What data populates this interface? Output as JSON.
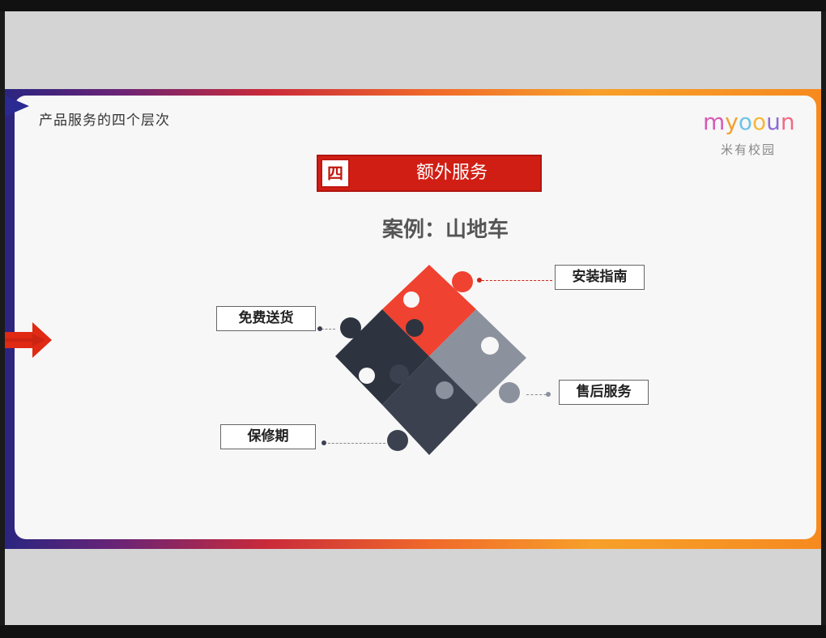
{
  "slide": {
    "section_title": "产品服务的四个层次",
    "logo": {
      "letters": [
        "m",
        "y",
        "o",
        "o",
        "u",
        "n"
      ],
      "letter_colors": [
        "#d65ab5",
        "#f2a030",
        "#6fc3e8",
        "#f6b83a",
        "#8d6cd6",
        "#f06a85"
      ],
      "subtitle": "米有校园"
    },
    "tag": {
      "number": "四",
      "label": "额外服务",
      "color": "#d11e14"
    },
    "case_title": "案例：山地车",
    "callouts": {
      "top_right": "安装指南",
      "left_upper": "免费送货",
      "right_lower": "售后服务",
      "left_lower": "保修期"
    },
    "colors": {
      "red_piece": "#f04230",
      "gray_piece": "#8c919e",
      "dark_piece": "#2e3340",
      "navy_piece": "#3c4150",
      "accent_red": "#c9271b"
    },
    "icons": [
      "nav-triangle-icon",
      "next-arrow-icon"
    ]
  }
}
